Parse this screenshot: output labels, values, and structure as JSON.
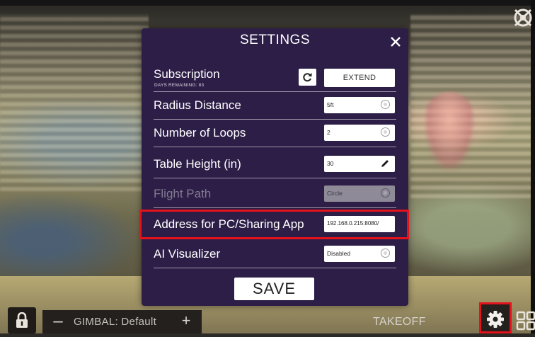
{
  "modal": {
    "title": "SETTINGS",
    "save_label": "SAVE",
    "subscription": {
      "label": "Subscription",
      "days_remaining": "DAYS REMAINING: 83",
      "extend_label": "EXTEND"
    },
    "rows": {
      "radius": {
        "label": "Radius Distance",
        "value": "5ft"
      },
      "loops": {
        "label": "Number of Loops",
        "value": "2"
      },
      "table_height": {
        "label": "Table Height (in)",
        "value": "30"
      },
      "flight_path": {
        "label": "Flight Path",
        "value": "Circle"
      },
      "address": {
        "label": "Address for PC/Sharing App",
        "value": "192.168.0.215:8080/"
      },
      "ai_visualizer": {
        "label": "AI Visualizer",
        "value": "Disabled"
      }
    }
  },
  "bottom_bar": {
    "gimbal_minus": "–",
    "gimbal_label": "GIMBAL: Default",
    "gimbal_plus": "+",
    "takeoff_label": "TAKEOFF"
  },
  "colors": {
    "modal_bg": "#2d1e47",
    "highlight": "#e3121b"
  },
  "icons": [
    "obstacle-avoidance-icon",
    "close-icon",
    "refresh-icon",
    "pencil-icon",
    "lock-icon",
    "gear-icon",
    "grid-icon"
  ]
}
